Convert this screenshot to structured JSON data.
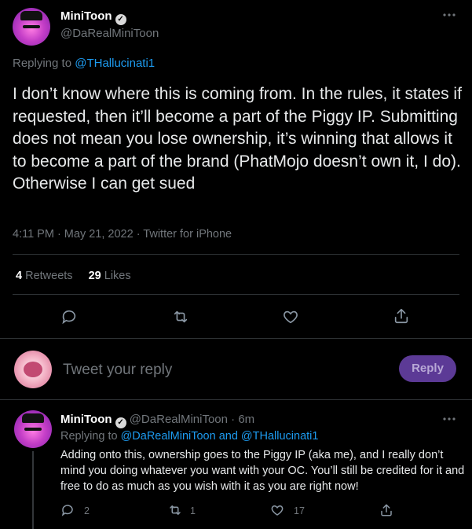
{
  "tweet": {
    "author_name": "MiniToon",
    "author_handle": "@DaRealMiniToon",
    "replying_prefix": "Replying to",
    "replying_to": "@THallucinati1",
    "text": "I don’t know where this is coming from. In the rules, it states if requested, then it’ll become a part of the Piggy IP. Submitting does not mean you lose ownership, it’s winning that allows it to become a part of the brand (PhatMojo doesn’t own it, I do). Otherwise I can get sued",
    "meta": "4:11 PM · May 21, 2022 · Twitter for iPhone",
    "retweets_count": "4",
    "retweets_label": "Retweets",
    "likes_count": "29",
    "likes_label": "Likes",
    "more_icon": "more-icon"
  },
  "composer": {
    "placeholder": "Tweet your reply",
    "reply_label": "Reply"
  },
  "reply": {
    "author_name": "MiniToon",
    "author_handle": "@DaRealMiniToon",
    "time": "· 6m",
    "replying_prefix": "Replying to",
    "replying_to": "@DaRealMiniToon and @THallucinati1",
    "text": "Adding onto this, ownership goes to the Piggy IP (aka me), and I really don’t mind you doing whatever you want with your OC. You’ll still be credited for it and free to do as much as you wish with it as you are right now!",
    "reply_count": "2",
    "retweet_count": "1",
    "like_count": "17"
  },
  "colors": {
    "background": "#000000",
    "text": "#d9d9d9",
    "muted": "#71767b",
    "link": "#1d9bf0",
    "reply_button": "#5c3a96"
  }
}
